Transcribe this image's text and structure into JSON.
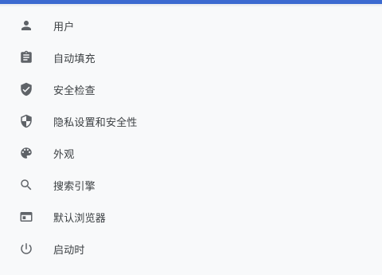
{
  "colors": {
    "accent_bar": "#3c6ad0",
    "background": "#f8f9fa",
    "icon": "#5f6368",
    "text": "#3c4043"
  },
  "menu": {
    "items": [
      {
        "label": "用户",
        "icon": "person-icon"
      },
      {
        "label": "自动填充",
        "icon": "clipboard-icon"
      },
      {
        "label": "安全检查",
        "icon": "shield-check-icon"
      },
      {
        "label": "隐私设置和安全性",
        "icon": "privacy-shield-icon"
      },
      {
        "label": "外观",
        "icon": "palette-icon"
      },
      {
        "label": "搜索引擎",
        "icon": "search-icon"
      },
      {
        "label": "默认浏览器",
        "icon": "browser-window-icon"
      },
      {
        "label": "启动时",
        "icon": "power-icon"
      }
    ]
  }
}
